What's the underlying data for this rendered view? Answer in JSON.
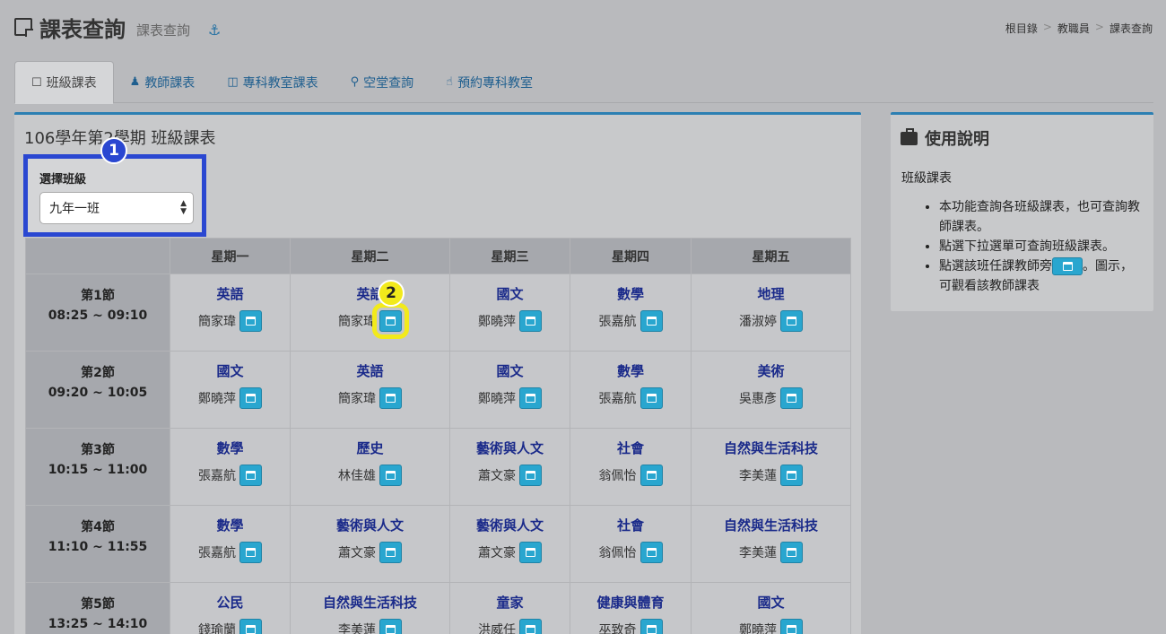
{
  "header": {
    "title": "課表查詢",
    "subtitle": "課表查詢"
  },
  "breadcrumb": [
    "根目錄",
    "教職員",
    "課表查詢"
  ],
  "tabs": [
    {
      "label": "班級課表",
      "icon": "square-icon"
    },
    {
      "label": "教師課表",
      "icon": "person-icon"
    },
    {
      "label": "專科教室課表",
      "icon": "columns-icon"
    },
    {
      "label": "空堂查詢",
      "icon": "search-icon"
    },
    {
      "label": "預約專科教室",
      "icon": "hand-pointer-icon"
    }
  ],
  "panel": {
    "title": "106學年第2學期 班級課表"
  },
  "select": {
    "label": "選擇班級",
    "value": "九年一班"
  },
  "badges": {
    "one": "1",
    "two": "2"
  },
  "days": [
    "星期一",
    "星期二",
    "星期三",
    "星期四",
    "星期五"
  ],
  "periods": [
    {
      "name": "第1節",
      "time": "08:25 ~ 09:10",
      "cells": [
        {
          "subject": "英語",
          "teacher": "簡家瑋"
        },
        {
          "subject": "英語",
          "teacher": "簡家瑋"
        },
        {
          "subject": "國文",
          "teacher": "鄭曉萍"
        },
        {
          "subject": "數學",
          "teacher": "張嘉航"
        },
        {
          "subject": "地理",
          "teacher": "潘淑婷"
        }
      ]
    },
    {
      "name": "第2節",
      "time": "09:20 ~ 10:05",
      "cells": [
        {
          "subject": "國文",
          "teacher": "鄭曉萍"
        },
        {
          "subject": "英語",
          "teacher": "簡家瑋"
        },
        {
          "subject": "國文",
          "teacher": "鄭曉萍"
        },
        {
          "subject": "數學",
          "teacher": "張嘉航"
        },
        {
          "subject": "美術",
          "teacher": "吳惠彥"
        }
      ]
    },
    {
      "name": "第3節",
      "time": "10:15 ~ 11:00",
      "cells": [
        {
          "subject": "數學",
          "teacher": "張嘉航"
        },
        {
          "subject": "歷史",
          "teacher": "林佳雄"
        },
        {
          "subject": "藝術與人文",
          "teacher": "蕭文豪"
        },
        {
          "subject": "社會",
          "teacher": "翁佩怡"
        },
        {
          "subject": "自然與生活科技",
          "teacher": "李美蓮"
        }
      ]
    },
    {
      "name": "第4節",
      "time": "11:10 ~ 11:55",
      "cells": [
        {
          "subject": "數學",
          "teacher": "張嘉航"
        },
        {
          "subject": "藝術與人文",
          "teacher": "蕭文豪"
        },
        {
          "subject": "藝術與人文",
          "teacher": "蕭文豪"
        },
        {
          "subject": "社會",
          "teacher": "翁佩怡"
        },
        {
          "subject": "自然與生活科技",
          "teacher": "李美蓮"
        }
      ]
    },
    {
      "name": "第5節",
      "time": "13:25 ~ 14:10",
      "cells": [
        {
          "subject": "公民",
          "teacher": "錢瑜蘭"
        },
        {
          "subject": "自然與生活科技",
          "teacher": "李美蓮"
        },
        {
          "subject": "童家",
          "teacher": "洪威任"
        },
        {
          "subject": "健康與體育",
          "teacher": "巫致奇"
        },
        {
          "subject": "國文",
          "teacher": "鄭曉萍"
        }
      ]
    }
  ],
  "help": {
    "title": "使用說明",
    "subtitle": "班級課表",
    "item1": "本功能查詢各班級課表，也可查詢教師課表。",
    "item2": "點選下拉選單可查詢班級課表。",
    "item3a": "點選該班任課教師旁",
    "item3b": "。圖示， 可觀看該教師課表"
  },
  "colors": {
    "accent": "#2c7fb2",
    "calendar_button": "#29a6cf",
    "highlight_blue": "#2a47d1",
    "highlight_yellow": "#f2ea1b",
    "subject_text": "#1a2a8a"
  }
}
